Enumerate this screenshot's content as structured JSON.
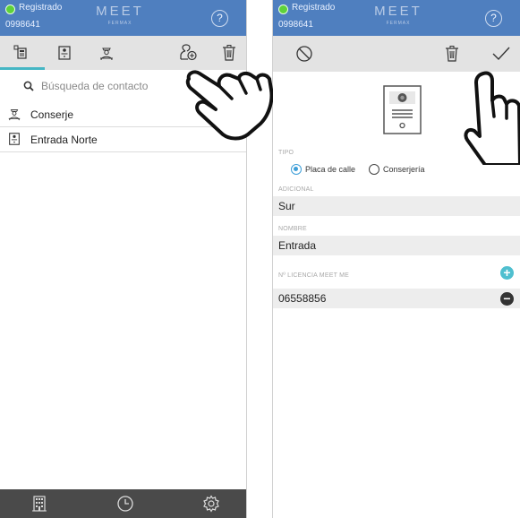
{
  "colors": {
    "header": "#4f7fbf",
    "status_ok": "#5ed23a",
    "toolbar": "#e3e3e3",
    "accent": "#45b6c4",
    "nav": "#4a4a4a"
  },
  "left": {
    "status": {
      "label": "Registrado",
      "id": "0998641"
    },
    "brand": {
      "name": "MEET",
      "maker": "FERMAX"
    },
    "help": "?",
    "toolbar_icons": [
      "panel-list-icon",
      "street-panel-icon",
      "concierge-icon",
      "add-contact-icon",
      "trash-icon"
    ],
    "search": {
      "placeholder": "Búsqueda de contacto"
    },
    "contacts": [
      {
        "name": "Conserje",
        "icon": "concierge-icon"
      },
      {
        "name": "Entrada Norte",
        "icon": "street-panel-icon"
      }
    ],
    "nav_icons": [
      "building-icon",
      "clock-icon",
      "gear-icon"
    ]
  },
  "right": {
    "status": {
      "label": "Registrado",
      "id": "0998641"
    },
    "brand": {
      "name": "MEET",
      "maker": "FERMAX"
    },
    "help": "?",
    "toolbar_icons": [
      "cancel-icon",
      "trash-icon",
      "check-icon"
    ],
    "device_icon": "street-panel-icon",
    "tipo": {
      "label": "TIPO",
      "options": [
        "Placa de calle",
        "Conserjería"
      ],
      "selected": "Placa de calle"
    },
    "adicional": {
      "label": "ADICIONAL",
      "value": "Sur"
    },
    "nombre": {
      "label": "NOMBRE",
      "value": "Entrada"
    },
    "licencia": {
      "label": "Nº LICENCIA MEET ME",
      "value": "06558856"
    }
  }
}
